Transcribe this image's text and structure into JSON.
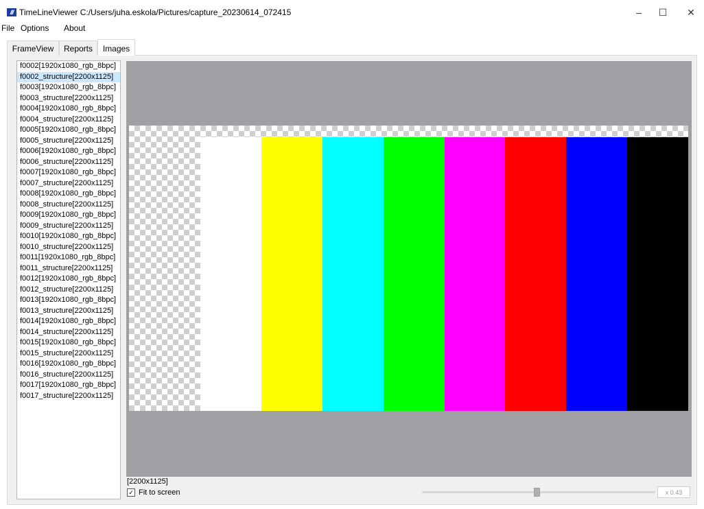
{
  "window": {
    "app_icon": "timelineviewer-logo-icon",
    "title": "TimeLineViewer C:/Users/juha.eskola/Pictures/capture_20230614_072415",
    "controls": {
      "minimize": "–",
      "maximize": "☐",
      "close": "✕"
    }
  },
  "menu": [
    "File",
    "Options",
    "About"
  ],
  "tabs": [
    {
      "label": "FrameView",
      "active": false
    },
    {
      "label": "Reports",
      "active": false
    },
    {
      "label": "Images",
      "active": true
    }
  ],
  "image_list": {
    "selected_index": 1,
    "items": [
      "f0002[1920x1080_rgb_8bpc]",
      "f0002_structure[2200x1125]",
      "f0003[1920x1080_rgb_8bpc]",
      "f0003_structure[2200x1125]",
      "f0004[1920x1080_rgb_8bpc]",
      "f0004_structure[2200x1125]",
      "f0005[1920x1080_rgb_8bpc]",
      "f0005_structure[2200x1125]",
      "f0006[1920x1080_rgb_8bpc]",
      "f0006_structure[2200x1125]",
      "f0007[1920x1080_rgb_8bpc]",
      "f0007_structure[2200x1125]",
      "f0008[1920x1080_rgb_8bpc]",
      "f0008_structure[2200x1125]",
      "f0009[1920x1080_rgb_8bpc]",
      "f0009_structure[2200x1125]",
      "f0010[1920x1080_rgb_8bpc]",
      "f0010_structure[2200x1125]",
      "f0011[1920x1080_rgb_8bpc]",
      "f0011_structure[2200x1125]",
      "f0012[1920x1080_rgb_8bpc]",
      "f0012_structure[2200x1125]",
      "f0013[1920x1080_rgb_8bpc]",
      "f0013_structure[2200x1125]",
      "f0014[1920x1080_rgb_8bpc]",
      "f0014_structure[2200x1125]",
      "f0015[1920x1080_rgb_8bpc]",
      "f0015_structure[2200x1125]",
      "f0016[1920x1080_rgb_8bpc]",
      "f0016_structure[2200x1125]",
      "f0017[1920x1080_rgb_8bpc]",
      "f0017_structure[2200x1125]"
    ]
  },
  "viewer": {
    "background_color": "#a0a0a4",
    "color_bars": [
      "#ffffff",
      "#ffff00",
      "#00ffff",
      "#00ff00",
      "#ff00ff",
      "#ff0000",
      "#0000ff",
      "#000000"
    ]
  },
  "footer": {
    "image_size": "[2200x1125]",
    "fit_to_screen_label": "Fit to screen",
    "fit_to_screen_checked": true,
    "zoom_value": "x 0.43",
    "zoom_slider_fraction": 0.49
  }
}
